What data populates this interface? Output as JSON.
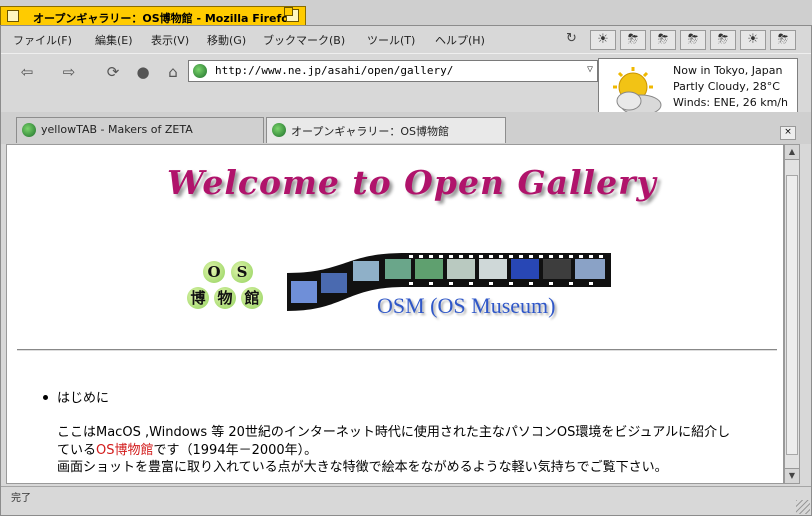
{
  "window": {
    "title": "オープンギャラリー：OS博物館 - Mozilla Firefox"
  },
  "menu": [
    "ファイル(F)",
    "編集(E)",
    "表示(V)",
    "移動(G)",
    "ブックマーク(B)",
    "ツール(T)",
    "ヘルプ(H)"
  ],
  "address": {
    "url": "http://www.ne.jp/asahi/open/gallery/"
  },
  "weather": {
    "location": "Now in Tokyo, Japan",
    "condition": "Partly Cloudy, 28°C",
    "wind": "Winds: ENE, 26 km/h"
  },
  "tabs": [
    {
      "label": "yellowTAB - Makers of ZETA",
      "active": false
    },
    {
      "label": "オープンギャラリー：OS博物館",
      "active": true
    }
  ],
  "page": {
    "headline": "Welcome to Open Gallery",
    "logo_chars": [
      "O",
      "S",
      "博",
      "物",
      "館"
    ],
    "osm_caption": "OSM (OS Museum)",
    "list_item": "はじめに",
    "para1a": "ここはMacOS ,Windows 等 20世紀のインターネット時代に使用された主なパソコンOS環境をビジュアルに紹介し",
    "para1b_pre": "ている",
    "para1b_link": "OS博物館",
    "para1b_post": "です（1994年－2000年）。",
    "para2": "画面ショットを豊富に取り入れている点が大きな特徴で絵本をながめるような軽い気持ちでご覧下さい。"
  },
  "status": {
    "text": "完了"
  },
  "colors": {
    "title_tab": "#ffcb00",
    "headline": "#b0136b",
    "osm_caption": "#2f57c8",
    "link": "#d21a1a"
  }
}
